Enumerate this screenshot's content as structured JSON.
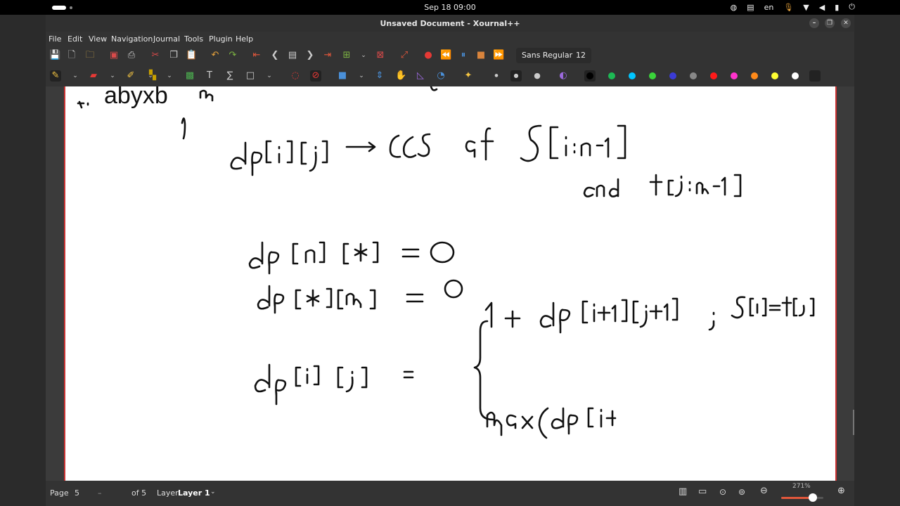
{
  "topbar": {
    "clock": "Sep 18  09:00",
    "keyboard_layout": "en"
  },
  "window": {
    "title": "Unsaved Document - Xournal++"
  },
  "menu": [
    "File",
    "Edit",
    "View",
    "Navigation",
    "Journal",
    "Tools",
    "Plugin",
    "Help"
  ],
  "toolbar": {
    "font_name": "Sans Regular",
    "font_size": "12"
  },
  "colors": {
    "accent": "#e2573b",
    "page_border": "#cc3333",
    "palette": [
      "#000000",
      "#1db954",
      "#00c5ff",
      "#3ad33a",
      "#3b3bd6",
      "#888888",
      "#ff1a1a",
      "#ff33cc",
      "#ff8a1a",
      "#ffff33",
      "#ffffff"
    ]
  },
  "statusbar": {
    "page_label": "Page",
    "page_value": "5",
    "page_separator": "–",
    "of_pages": "of 5",
    "layer_label": "Layer",
    "layer_value": "Layer 1",
    "zoom": "271%",
    "zoom_fraction": 0.75
  },
  "page_content": {
    "typed_text": "abyxb"
  }
}
